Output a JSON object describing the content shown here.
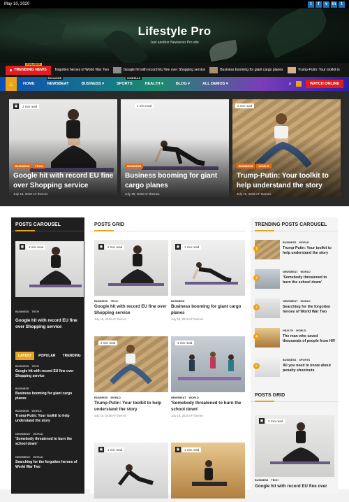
{
  "topbar": {
    "date": "May 10, 2020",
    "social": [
      "t",
      "f",
      "v",
      "in",
      "t"
    ]
  },
  "header": {
    "title": "Lifestyle Pro",
    "tagline": "Just another Newsever Pro site"
  },
  "ticker": {
    "label": "TRENDING NEWS",
    "badge": "EXCLUSIVE",
    "items": [
      "forgotten heroes of World War Two",
      "Google hit with record EU fine over Shopping service",
      "Business booming for giant cargo planes",
      "Trump-Putin: Your toolkit to"
    ]
  },
  "nav": {
    "items": [
      "HOME",
      "NEWSBEAT",
      "BUSINESS",
      "SPORTS",
      "HEALTH",
      "BLOG",
      "ALL DEMOS"
    ],
    "badges": {
      "newsbeat": "EXCLUSIVE",
      "sports": "SCHEDULE"
    },
    "watch": "WATCH ONLINE"
  },
  "featured": [
    {
      "read": "2 min read",
      "cats": [
        "BUSINESS",
        "TECH"
      ],
      "title": "Google hit with record EU fine over Shopping service",
      "meta": "July 18, 2018  AF themes"
    },
    {
      "read": "1 min read",
      "cats": [
        "BUSINESS"
      ],
      "title": "Business booming for giant cargo planes",
      "meta": "July 18, 2018  AF themes"
    },
    {
      "read": "2 min read",
      "cats": [
        "BUSINESS",
        "WORLD"
      ],
      "title": "Trump-Putin: Your toolkit to help understand the story",
      "meta": "July 18, 2018  AF themes"
    }
  ],
  "left": {
    "section": "POSTS CAROUSEL",
    "read": "2 min read",
    "cats": [
      "BUSINESS",
      "TECH"
    ],
    "title": "Google hit with record EU fine over Shopping service",
    "tabs": [
      "LATEST",
      "POPULAR",
      "TRENDING"
    ],
    "list": [
      {
        "cats": [
          "BUSINESS",
          "TECH"
        ],
        "title": "Google hit with record EU fine over Shopping service"
      },
      {
        "cats": [
          "BUSINESS"
        ],
        "title": "Business booming for giant cargo planes"
      },
      {
        "cats": [
          "BUSINESS",
          "WORLD"
        ],
        "title": "Trump-Putin: Your toolkit to help understand the story"
      },
      {
        "cats": [
          "NEWSBEAT",
          "WORLD"
        ],
        "title": "'Somebody threatened to burn the school down'"
      },
      {
        "cats": [
          "NEWSBEAT",
          "WORLD"
        ],
        "title": "Searching for the forgotten heroes of World War Two"
      }
    ]
  },
  "grid": {
    "section": "POSTS GRID",
    "cells": [
      {
        "read": "2 min read",
        "cats": [
          "BUSINESS",
          "TECH"
        ],
        "title": "Google hit with record EU fine over Shopping service",
        "meta": "July 18, 2018  AF themes"
      },
      {
        "read": "1 min read",
        "cats": [
          "BUSINESS"
        ],
        "title": "Business booming for giant cargo planes",
        "meta": "July 18, 2018  AF themes"
      },
      {
        "read": "2 min read",
        "cats": [
          "BUSINESS",
          "WORLD"
        ],
        "title": "Trump-Putin: Your toolkit to help understand the story",
        "meta": "July 18, 2018  AF themes"
      },
      {
        "read": "1 min read",
        "cats": [
          "NEWSBEAT",
          "WORLD"
        ],
        "title": "'Somebody threatened to burn the school down'",
        "meta": "July 18, 2018  AF themes"
      },
      {
        "read": "1 min read"
      },
      {
        "read": "1 min read"
      }
    ]
  },
  "right": {
    "section": "TRENDING POSTS CAROUSEL",
    "items": [
      {
        "num": "1",
        "cats": [
          "BUSINESS",
          "WORLD"
        ],
        "title": "Trump-Putin: Your toolkit to help understand the story"
      },
      {
        "num": "2",
        "cats": [
          "NEWSBEAT",
          "WORLD"
        ],
        "title": "'Somebody threatened to burn the school down'"
      },
      {
        "num": "3",
        "cats": [
          "NEWSBEAT",
          "WORLD"
        ],
        "title": "Searching for the forgotten heroes of World War Two"
      },
      {
        "num": "4",
        "cats": [
          "HEALTH",
          "WORLD"
        ],
        "title": "The man who saved thousands of people from HIV"
      },
      {
        "num": "5",
        "cats": [
          "BUSINESS",
          "SPORTS"
        ],
        "title": "All you need to know about penalty shootouts"
      }
    ],
    "section2": "POSTS GRID",
    "grid_read": "2 min read",
    "grid_cats": [
      "BUSINESS",
      "TECH"
    ],
    "grid_title": "Google hit with record EU fine over"
  }
}
